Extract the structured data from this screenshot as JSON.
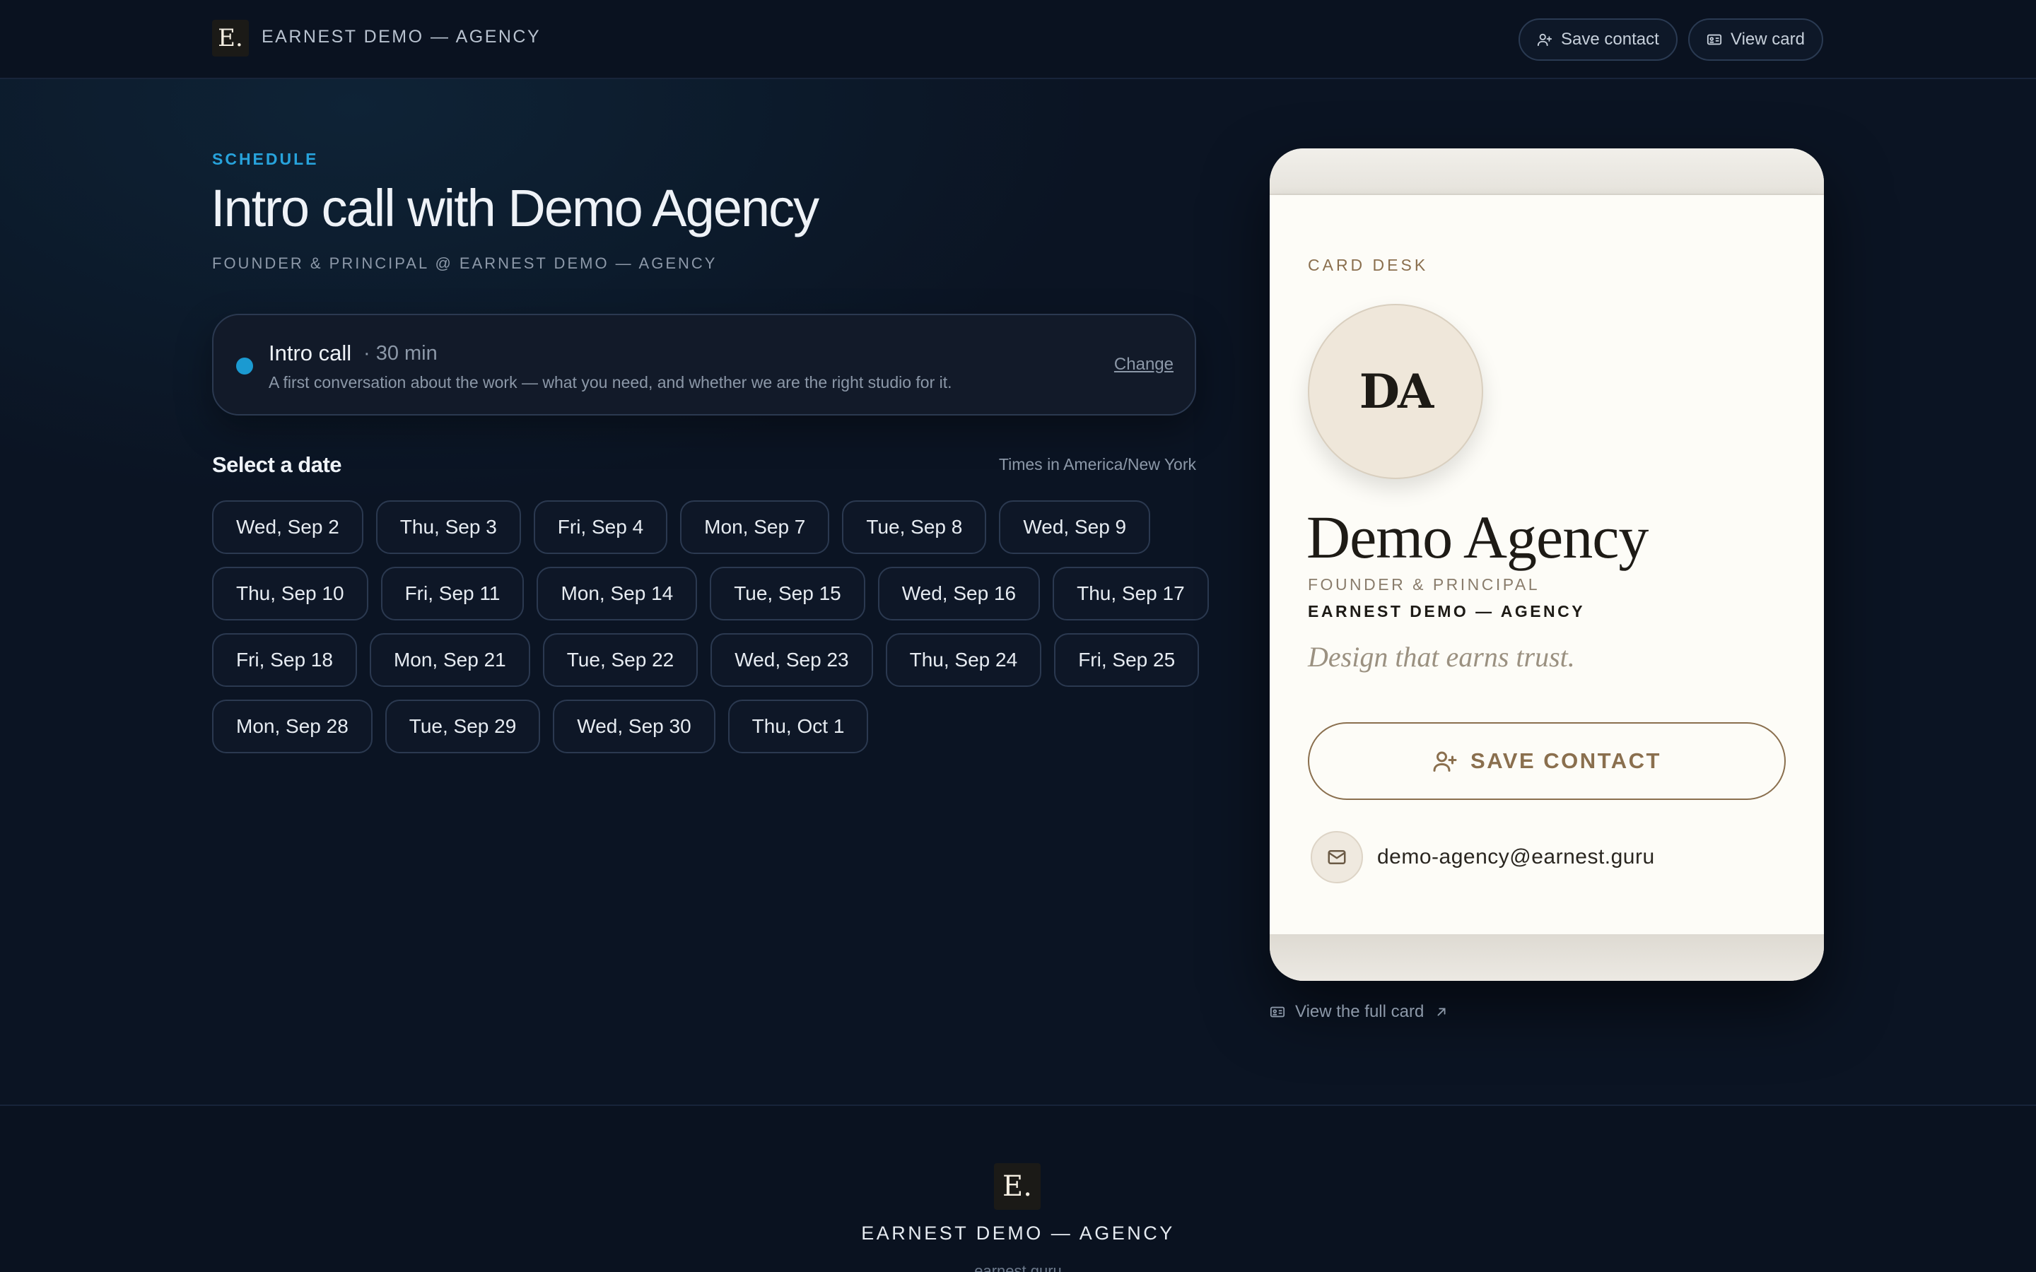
{
  "header": {
    "logo_letter": "E.",
    "brand": "EARNEST DEMO — AGENCY",
    "save_contact_label": "Save contact",
    "view_card_label": "View card"
  },
  "main": {
    "eyebrow": "SCHEDULE",
    "title": "Intro call with Demo Agency",
    "subtitle": "FOUNDER & PRINCIPAL @ EARNEST DEMO — AGENCY",
    "event": {
      "name": "Intro call",
      "duration": "· 30 min",
      "description": "A first conversation about the work — what you need, and whether we are the right studio for it.",
      "change_label": "Change",
      "accent_color": "#1b9ad1"
    },
    "date_section_title": "Select a date",
    "timezone_note": "Times in America/New York",
    "dates": [
      "Wed, Sep 2",
      "Thu, Sep 3",
      "Fri, Sep 4",
      "Mon, Sep 7",
      "Tue, Sep 8",
      "Wed, Sep 9",
      "Thu, Sep 10",
      "Fri, Sep 11",
      "Mon, Sep 14",
      "Tue, Sep 15",
      "Wed, Sep 16",
      "Thu, Sep 17",
      "Fri, Sep 18",
      "Mon, Sep 21",
      "Tue, Sep 22",
      "Wed, Sep 23",
      "Thu, Sep 24",
      "Fri, Sep 25",
      "Mon, Sep 28",
      "Tue, Sep 29",
      "Wed, Sep 30",
      "Thu, Oct 1"
    ]
  },
  "card": {
    "eyebrow": "CARD DESK",
    "initials": "DA",
    "name": "Demo Agency",
    "role": "FOUNDER & PRINCIPAL",
    "company": "EARNEST DEMO — AGENCY",
    "tagline": "Design that earns trust.",
    "save_label": "SAVE CONTACT",
    "email": "demo-agency@earnest.guru",
    "accent_color": "#8a6f4e",
    "view_full_label": "View the full card"
  },
  "footer": {
    "logo_letter": "E.",
    "brand": "EARNEST DEMO — AGENCY",
    "domain": "earnest.guru"
  }
}
